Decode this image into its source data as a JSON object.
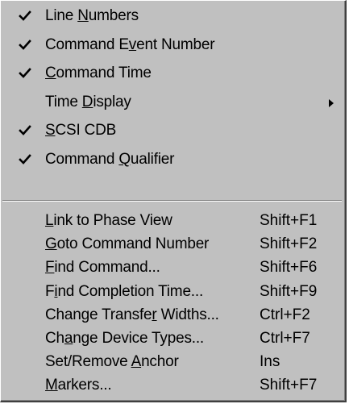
{
  "menu": {
    "top_items": [
      {
        "checked": true,
        "pre": "Line ",
        "mnemonic": "N",
        "post": "umbers"
      },
      {
        "checked": true,
        "pre": "Command E",
        "mnemonic": "v",
        "post": "ent Number"
      },
      {
        "checked": true,
        "pre": "",
        "mnemonic": "C",
        "post": "ommand Time"
      },
      {
        "checked": false,
        "pre": "Time ",
        "mnemonic": "D",
        "post": "isplay",
        "submenu": true
      },
      {
        "checked": true,
        "pre": "",
        "mnemonic": "S",
        "post": "CSI CDB"
      },
      {
        "checked": true,
        "pre": "Command ",
        "mnemonic": "Q",
        "post": "ualifier"
      }
    ],
    "bottom_items": [
      {
        "pre": "",
        "mnemonic": "L",
        "post": "ink to Phase View",
        "shortcut": "Shift+F1"
      },
      {
        "pre": "",
        "mnemonic": "G",
        "post": "oto Command Number",
        "shortcut": "Shift+F2"
      },
      {
        "pre": "",
        "mnemonic": "F",
        "post": "ind Command...",
        "shortcut": "Shift+F6"
      },
      {
        "pre": "F",
        "mnemonic": "i",
        "post": "nd Completion Time...",
        "shortcut": "Shift+F9"
      },
      {
        "pre": "Change Transfe",
        "mnemonic": "r",
        "post": " Widths...",
        "shortcut": "Ctrl+F2"
      },
      {
        "pre": "Ch",
        "mnemonic": "a",
        "post": "nge Device Types...",
        "shortcut": "Ctrl+F7"
      },
      {
        "pre": "Set/Remove ",
        "mnemonic": "A",
        "post": "nchor",
        "shortcut": "Ins"
      },
      {
        "pre": "",
        "mnemonic": "M",
        "post": "arkers...",
        "shortcut": "Shift+F7"
      }
    ]
  },
  "icons": {
    "check": "check-icon",
    "submenu_arrow": "submenu-arrow-icon"
  },
  "colors": {
    "menu_bg": "#c0c0c0",
    "text": "#000000",
    "shadow": "#808080",
    "highlight": "#ffffff"
  }
}
